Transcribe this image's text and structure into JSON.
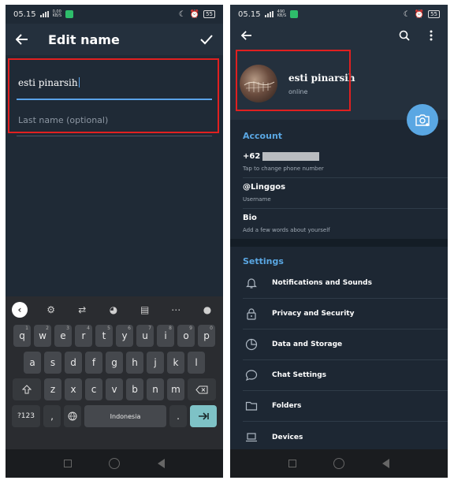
{
  "left": {
    "status": {
      "time": "05.15",
      "net_top": "0,00",
      "net_bottom": "KB/S",
      "battery": "55"
    },
    "header": {
      "title": "Edit name"
    },
    "first_name": {
      "value": "esti pinarsih"
    },
    "last_name": {
      "placeholder": "Last name (optional)"
    },
    "keyboard": {
      "row1": [
        {
          "k": "q",
          "n": "1"
        },
        {
          "k": "w",
          "n": "2"
        },
        {
          "k": "e",
          "n": "3"
        },
        {
          "k": "r",
          "n": "4"
        },
        {
          "k": "t",
          "n": "5"
        },
        {
          "k": "y",
          "n": "6"
        },
        {
          "k": "u",
          "n": "7"
        },
        {
          "k": "i",
          "n": "8"
        },
        {
          "k": "o",
          "n": "9"
        },
        {
          "k": "p",
          "n": "0"
        }
      ],
      "row2": [
        "a",
        "s",
        "d",
        "f",
        "g",
        "h",
        "j",
        "k",
        "l"
      ],
      "row3": [
        "z",
        "x",
        "c",
        "v",
        "b",
        "n",
        "m"
      ],
      "sym_label": "?123",
      "comma": ",",
      "space_label": "Indonesia",
      "period": "."
    }
  },
  "right": {
    "status": {
      "time": "05.15",
      "net_top": "490",
      "net_bottom": "KB/S",
      "battery": "55"
    },
    "profile": {
      "name": "esti pinarsih",
      "status": "online"
    },
    "account": {
      "title": "Account",
      "phone_prefix": "+62",
      "phone_hint": "Tap to change phone number",
      "username": "@Linggos",
      "username_hint": "Username",
      "bio": "Bio",
      "bio_hint": "Add a few words about yourself"
    },
    "settings": {
      "title": "Settings",
      "items": [
        {
          "label": "Notifications and Sounds",
          "icon": "bell-icon"
        },
        {
          "label": "Privacy and Security",
          "icon": "lock-icon"
        },
        {
          "label": "Data and Storage",
          "icon": "pie-chart-icon"
        },
        {
          "label": "Chat Settings",
          "icon": "chat-bubble-icon"
        },
        {
          "label": "Folders",
          "icon": "folder-icon"
        },
        {
          "label": "Devices",
          "icon": "laptop-icon"
        }
      ]
    }
  },
  "colors": {
    "highlight": "#e02020",
    "accent": "#5aa7e3",
    "keyboard_enter": "#7ec2c6"
  }
}
